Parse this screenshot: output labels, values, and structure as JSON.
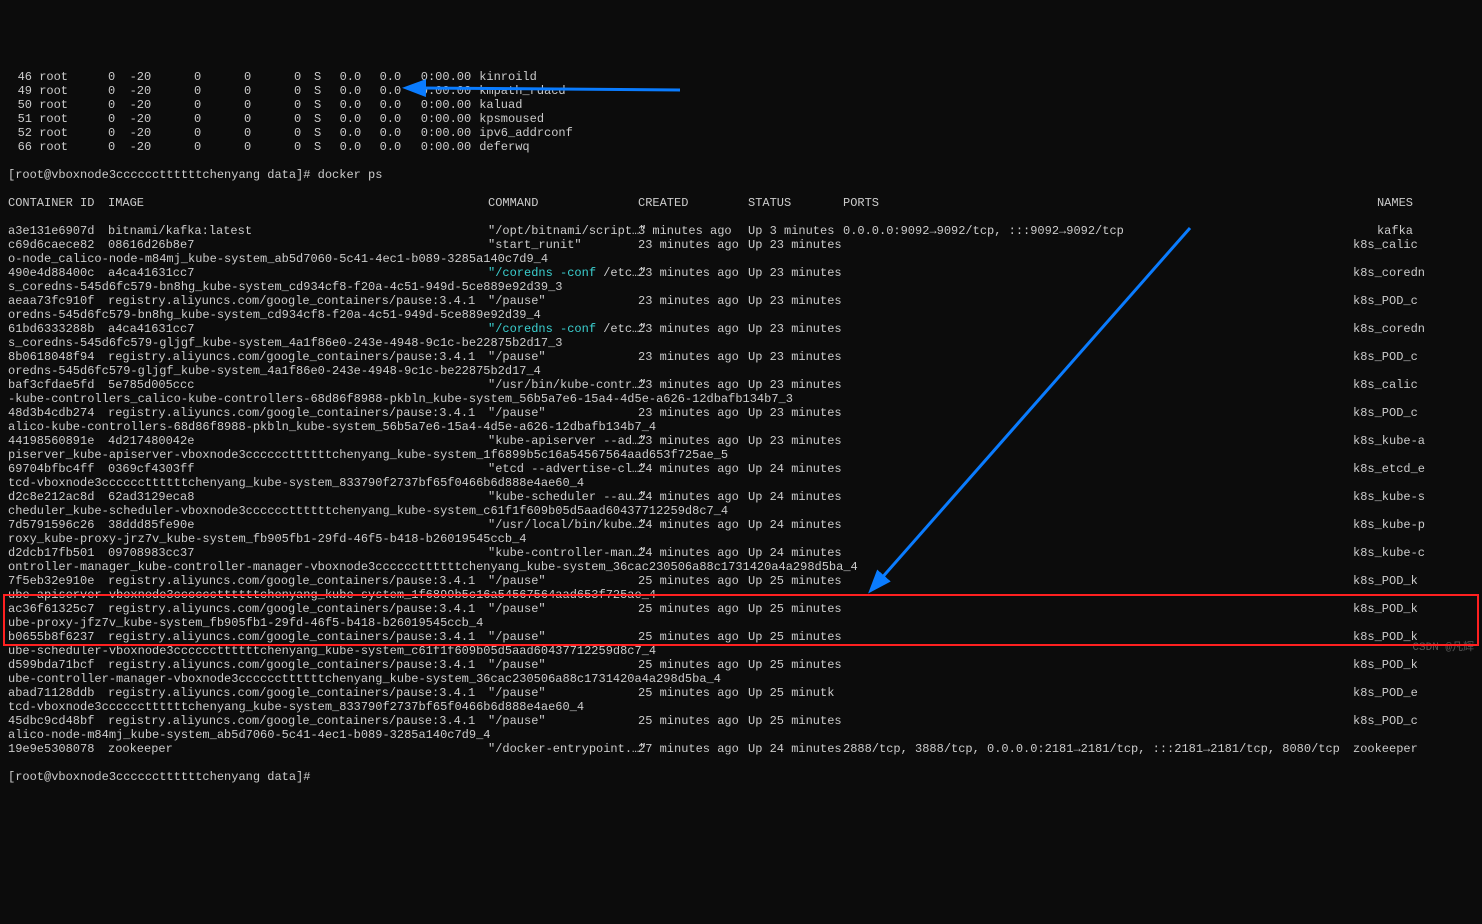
{
  "ps_rows": [
    {
      "pid": "46",
      "user": "root",
      "pr": "0",
      "ni": "-20",
      "virt": "0",
      "res": "0",
      "shr": "0",
      "s": "S",
      "cpu": "0.0",
      "mem": "0.0",
      "time": "0:00.00",
      "cmd": "kinroild"
    },
    {
      "pid": "49",
      "user": "root",
      "pr": "0",
      "ni": "-20",
      "virt": "0",
      "res": "0",
      "shr": "0",
      "s": "S",
      "cpu": "0.0",
      "mem": "0.0",
      "time": "0:00.00",
      "cmd": "kmpath_rdacd"
    },
    {
      "pid": "50",
      "user": "root",
      "pr": "0",
      "ni": "-20",
      "virt": "0",
      "res": "0",
      "shr": "0",
      "s": "S",
      "cpu": "0.0",
      "mem": "0.0",
      "time": "0:00.00",
      "cmd": "kaluad"
    },
    {
      "pid": "51",
      "user": "root",
      "pr": "0",
      "ni": "-20",
      "virt": "0",
      "res": "0",
      "shr": "0",
      "s": "S",
      "cpu": "0.0",
      "mem": "0.0",
      "time": "0:00.00",
      "cmd": "kpsmoused"
    },
    {
      "pid": "52",
      "user": "root",
      "pr": "0",
      "ni": "-20",
      "virt": "0",
      "res": "0",
      "shr": "0",
      "s": "S",
      "cpu": "0.0",
      "mem": "0.0",
      "time": "0:00.00",
      "cmd": "ipv6_addrconf"
    },
    {
      "pid": "66",
      "user": "root",
      "pr": "0",
      "ni": "-20",
      "virt": "0",
      "res": "0",
      "shr": "0",
      "s": "S",
      "cpu": "0.0",
      "mem": "0.0",
      "time": "0:00.00",
      "cmd": "deferwq"
    }
  ],
  "prompt1": "[root@vboxnode3ccccccttttttchenyang data]# docker ps",
  "prompt2": "[root@vboxnode3ccccccttttttchenyang data]#",
  "headers": {
    "id": "CONTAINER ID",
    "image": "IMAGE",
    "command": "COMMAND",
    "created": "CREATED",
    "status": "STATUS",
    "ports": "PORTS",
    "names": "NAMES"
  },
  "rows": [
    {
      "id": "a3e131e6907d",
      "image": "bitnami/kafka:latest",
      "cmd": "\"/opt/bitnami/script…\"",
      "created": "3 minutes ago",
      "status": "Up 3 minutes",
      "ports": "0.0.0.0:9092→9092/tcp, :::9092→9092/tcp",
      "names": "kafka",
      "wrap": ""
    },
    {
      "id": "c69d6caece82",
      "image": "08616d26b8e7",
      "cmd": "\"start_runit\"",
      "created": "23 minutes ago",
      "status": "Up 23 minutes",
      "ports": "",
      "names": "k8s_calic",
      "wrap": "o-node_calico-node-m84mj_kube-system_ab5d7060-5c41-4ec1-b089-3285a140c7d9_4"
    },
    {
      "id": "490e4d88400c",
      "image": "a4ca41631cc7",
      "cmd": "\"/coredns -conf /etc…\"",
      "created": "23 minutes ago",
      "status": "Up 23 minutes",
      "ports": "",
      "names": "k8s_coredn",
      "wrap": "s_coredns-545d6fc579-bn8hg_kube-system_cd934cf8-f20a-4c51-949d-5ce889e92d39_3",
      "cyan": true
    },
    {
      "id": "aeaa73fc910f",
      "image": "registry.aliyuncs.com/google_containers/pause:3.4.1",
      "cmd": "\"/pause\"",
      "created": "23 minutes ago",
      "status": "Up 23 minutes",
      "ports": "",
      "names": "k8s_POD_c",
      "wrap": "oredns-545d6fc579-bn8hg_kube-system_cd934cf8-f20a-4c51-949d-5ce889e92d39_4"
    },
    {
      "id": "61bd6333288b",
      "image": "a4ca41631cc7",
      "cmd": "\"/coredns -conf /etc…\"",
      "created": "23 minutes ago",
      "status": "Up 23 minutes",
      "ports": "",
      "names": "k8s_coredn",
      "wrap": "s_coredns-545d6fc579-gljgf_kube-system_4a1f86e0-243e-4948-9c1c-be22875b2d17_3",
      "cyan": true
    },
    {
      "id": "8b0618048f94",
      "image": "registry.aliyuncs.com/google_containers/pause:3.4.1",
      "cmd": "\"/pause\"",
      "created": "23 minutes ago",
      "status": "Up 23 minutes",
      "ports": "",
      "names": "k8s_POD_c",
      "wrap": "oredns-545d6fc579-gljgf_kube-system_4a1f86e0-243e-4948-9c1c-be22875b2d17_4"
    },
    {
      "id": "baf3cfdae5fd",
      "image": "5e785d005ccc",
      "cmd": "\"/usr/bin/kube-contr…\"",
      "created": "23 minutes ago",
      "status": "Up 23 minutes",
      "ports": "",
      "names": "k8s_calic",
      "wrap": "-kube-controllers_calico-kube-controllers-68d86f8988-pkbln_kube-system_56b5a7e6-15a4-4d5e-a626-12dbafb134b7_3"
    },
    {
      "id": "48d3b4cdb274",
      "image": "registry.aliyuncs.com/google_containers/pause:3.4.1",
      "cmd": "\"/pause\"",
      "created": "23 minutes ago",
      "status": "Up 23 minutes",
      "ports": "",
      "names": "k8s_POD_c",
      "wrap": "alico-kube-controllers-68d86f8988-pkbln_kube-system_56b5a7e6-15a4-4d5e-a626-12dbafb134b7_4"
    },
    {
      "id": "44198560891e",
      "image": "4d217480042e",
      "cmd": "\"kube-apiserver --ad…\"",
      "created": "23 minutes ago",
      "status": "Up 23 minutes",
      "ports": "",
      "names": "k8s_kube-a",
      "wrap": "piserver_kube-apiserver-vboxnode3ccccccttttttchenyang_kube-system_1f6899b5c16a54567564aad653f725ae_5"
    },
    {
      "id": "69704bfbc4ff",
      "image": "0369cf4303ff",
      "cmd": "\"etcd --advertise-cl…\"",
      "created": "24 minutes ago",
      "status": "Up 24 minutes",
      "ports": "",
      "names": "k8s_etcd_e",
      "wrap": "tcd-vboxnode3ccccccttttttchenyang_kube-system_833790f2737bf65f0466b6d888e4ae60_4"
    },
    {
      "id": "d2c8e212ac8d",
      "image": "62ad3129eca8",
      "cmd": "\"kube-scheduler --au…\"",
      "created": "24 minutes ago",
      "status": "Up 24 minutes",
      "ports": "",
      "names": "k8s_kube-s",
      "wrap": "cheduler_kube-scheduler-vboxnode3ccccccttttttchenyang_kube-system_c61f1f609b05d5aad60437712259d8c7_4"
    },
    {
      "id": "7d5791596c26",
      "image": "38ddd85fe90e",
      "cmd": "\"/usr/local/bin/kube…\"",
      "created": "24 minutes ago",
      "status": "Up 24 minutes",
      "ports": "",
      "names": "k8s_kube-p",
      "wrap": "roxy_kube-proxy-jrz7v_kube-system_fb905fb1-29fd-46f5-b418-b26019545ccb_4"
    },
    {
      "id": "d2dcb17fb501",
      "image": "09708983cc37",
      "cmd": "\"kube-controller-man…\"",
      "created": "24 minutes ago",
      "status": "Up 24 minutes",
      "ports": "",
      "names": "k8s_kube-c",
      "wrap": "ontroller-manager_kube-controller-manager-vboxnode3ccccccttttttchenyang_kube-system_36cac230506a88c1731420a4a298d5ba_4"
    },
    {
      "id": "7f5eb32e910e",
      "image": "registry.aliyuncs.com/google_containers/pause:3.4.1",
      "cmd": "\"/pause\"",
      "created": "25 minutes ago",
      "status": "Up 25 minutes",
      "ports": "",
      "names": "k8s_POD_k",
      "wrap": "ube-apiserver-vboxnode3ccccccttttttchenyang_kube-system_1f6899b5c16a54567564aad653f725ae_4"
    },
    {
      "id": "ac36f61325c7",
      "image": "registry.aliyuncs.com/google_containers/pause:3.4.1",
      "cmd": "\"/pause\"",
      "created": "25 minutes ago",
      "status": "Up 25 minutes",
      "ports": "",
      "names": "k8s_POD_k",
      "wrap": "ube-proxy-jfz7v_kube-system_fb905fb1-29fd-46f5-b418-b26019545ccb_4"
    },
    {
      "id": "b0655b8f6237",
      "image": "registry.aliyuncs.com/google_containers/pause:3.4.1",
      "cmd": "\"/pause\"",
      "created": "25 minutes ago",
      "status": "Up 25 minutes",
      "ports": "",
      "names": "k8s_POD_k",
      "wrap": "ube-scheduler-vboxnode3ccccccttttttchenyang_kube-system_c61f1f609b05d5aad60437712259d8c7_4"
    },
    {
      "id": "d599bda71bcf",
      "image": "registry.aliyuncs.com/google_containers/pause:3.4.1",
      "cmd": "\"/pause\"",
      "created": "25 minutes ago",
      "status": "Up 25 minutes",
      "ports": "",
      "names": "k8s_POD_k",
      "wrap": "ube-controller-manager-vboxnode3ccccccttttttchenyang_kube-system_36cac230506a88c1731420a4a298d5ba_4"
    },
    {
      "id": "abad71128ddb",
      "image": "registry.aliyuncs.com/google_containers/pause:3.4.1",
      "cmd": "\"/pause\"",
      "created": "25 minutes ago",
      "status": "Up 25 minutk",
      "ports": "",
      "names": "k8s_POD_e",
      "wrap": "tcd-vboxnode3ccccccttttttchenyang_kube-system_833790f2737bf65f0466b6d888e4ae60_4"
    },
    {
      "id": "45dbc9cd48bf",
      "image": "registry.aliyuncs.com/google_containers/pause:3.4.1",
      "cmd": "\"/pause\"",
      "created": "25 minutes ago",
      "status": "Up 25 minutes",
      "ports": "",
      "names": "k8s_POD_c",
      "wrap": "alico-node-m84mj_kube-system_ab5d7060-5c41-4ec1-b089-3285a140c7d9_4"
    },
    {
      "id": "19e9e5308078",
      "image": "zookeeper",
      "cmd": "\"/docker-entrypoint.…\"",
      "created": "27 minutes ago",
      "status": "Up 24 minutes",
      "ports": "2888/tcp, 3888/tcp, 0.0.0.0:2181→2181/tcp, :::2181→2181/tcp, 8080/tcp",
      "names": "zookeeper",
      "wrap": ""
    }
  ],
  "watermark": "CSDN @凡辉"
}
